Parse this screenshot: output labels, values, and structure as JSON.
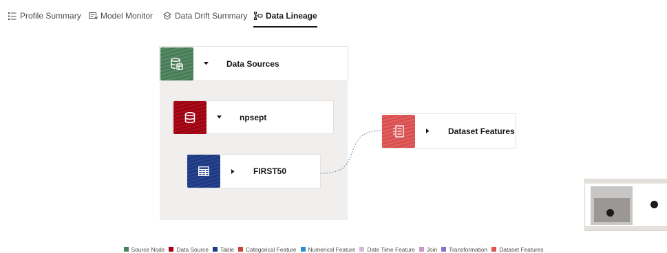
{
  "tabs": [
    {
      "label": "Profile Summary",
      "icon": "profile-summary-icon",
      "active": false
    },
    {
      "label": "Model Monitor",
      "icon": "model-monitor-icon",
      "active": false
    },
    {
      "label": "Data Drift Summary",
      "icon": "data-drift-icon",
      "active": false
    },
    {
      "label": "Data Lineage",
      "icon": "data-lineage-icon",
      "active": true
    }
  ],
  "nodes": {
    "sources": {
      "label": "Data Sources",
      "icon": "database-stack-icon",
      "color": "#4c825c"
    },
    "npsept": {
      "label": "npsept",
      "icon": "database-icon",
      "color": "#a4000f"
    },
    "first50": {
      "label": "FIRST50",
      "icon": "table-icon",
      "color": "#1c3a88"
    },
    "features": {
      "label": "Dataset Features",
      "icon": "feature-list-icon",
      "color": "#e25454"
    }
  },
  "legend": [
    {
      "label": "Source Node",
      "color": "#4c825c"
    },
    {
      "label": "Data Source",
      "color": "#a4000f"
    },
    {
      "label": "Table",
      "color": "#1c3a88"
    },
    {
      "label": "Categorical Feature",
      "color": "#c74634"
    },
    {
      "label": "Numerical Feature",
      "color": "#2b8ed2"
    },
    {
      "label": "Date Time Feature",
      "color": "#d7b7d6"
    },
    {
      "label": "Join",
      "color": "#c896c8"
    },
    {
      "label": "Transformation",
      "color": "#8c6fcf"
    },
    {
      "label": "Dataset Features",
      "color": "#e25454"
    }
  ]
}
